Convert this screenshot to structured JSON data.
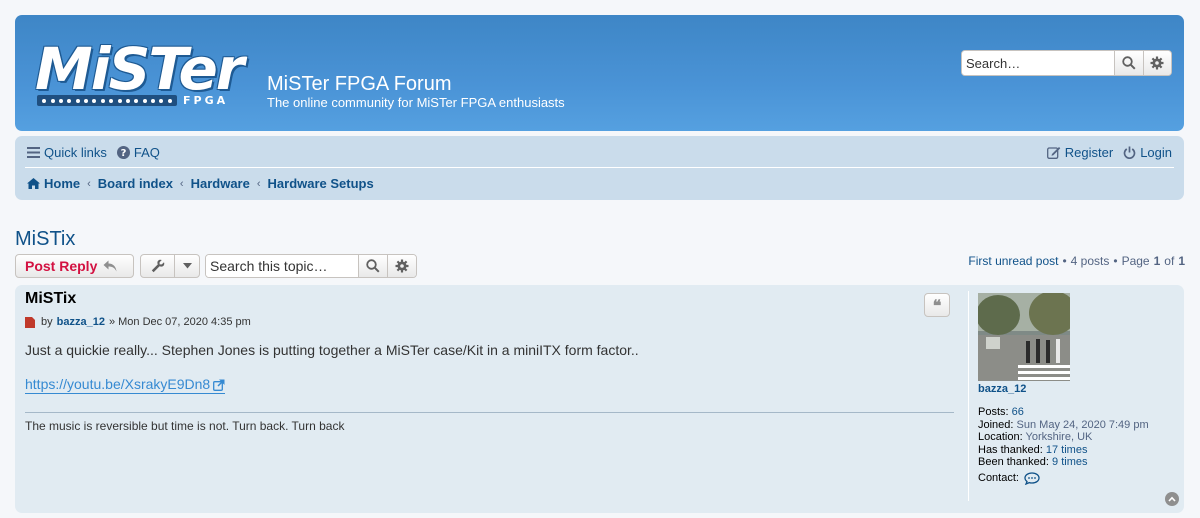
{
  "header": {
    "logo_text": "MiSTer",
    "logo_sub": "FPGA",
    "site_title": "MiSTer FPGA Forum",
    "site_description": "The online community for MiSTer FPGA enthusiasts",
    "search_placeholder": "Search…",
    "search_icon": "search-icon",
    "advanced_search_icon": "gear-icon"
  },
  "nav": {
    "quick_links": "Quick links",
    "faq": "FAQ",
    "register": "Register",
    "login": "Login",
    "breadcrumbs": [
      "Home",
      "Board index",
      "Hardware",
      "Hardware Setups"
    ]
  },
  "topic": {
    "title": "MiSTix",
    "post_reply_label": "Post Reply",
    "search_placeholder": "Search this topic…",
    "pagination": {
      "first_unread": "First unread post",
      "posts_count": "4 posts",
      "page_label": "Page",
      "current_page": "1",
      "of_label": "of",
      "total_pages": "1"
    }
  },
  "post": {
    "subject": "MiSTix",
    "by_label": "by",
    "author": "bazza_12",
    "date": "» Mon Dec 07, 2020 4:35 pm",
    "body": "Just a quickie really... Stephen Jones is putting together a MiSTer case/Kit in a miniITX form factor..",
    "link": "https://youtu.be/XsrakyE9Dn8",
    "signature": "The music is reversible but time is not. Turn back. Turn back"
  },
  "profile": {
    "username": "bazza_12",
    "posts_label": "Posts:",
    "posts": "66",
    "joined_label": "Joined:",
    "joined": "Sun May 24, 2020 7:49 pm",
    "location_label": "Location:",
    "location": "Yorkshire, UK",
    "has_thanked_label": "Has thanked:",
    "has_thanked": "17 times",
    "been_thanked_label": "Been thanked:",
    "been_thanked": "9 times",
    "contact_label": "Contact:"
  },
  "colors": {
    "header_blue": "#4a93d6",
    "nav_bg": "#cadceb",
    "post_bg": "#e1ebf2",
    "link": "#105289",
    "reply_red": "#d31141"
  }
}
